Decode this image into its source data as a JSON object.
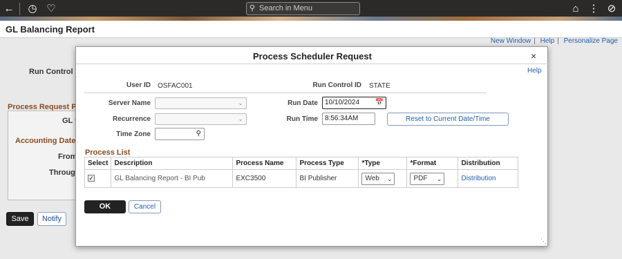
{
  "topbar": {
    "search_placeholder": "Search in Menu",
    "back_icon": "←",
    "history_icon": "◷",
    "favorites_icon": "♡",
    "home_icon": "⌂",
    "more_icon": "⋮",
    "navbar_icon": "⊘"
  },
  "page": {
    "title": "GL Balancing Report",
    "links": [
      "New Window",
      "Help",
      "Personalize Page"
    ],
    "run_control_label": "Run Control ID",
    "section_process_request": "Process Request Param",
    "gl_label": "GL U",
    "accounting_date": "Accounting Date",
    "from_label": "From",
    "through_label": "Through",
    "save_button": "Save",
    "notify_button": "Notify"
  },
  "modal": {
    "title": "Process Scheduler Request",
    "close_icon": "×",
    "help_link": "Help",
    "user_id_label": "User ID",
    "user_id_value": "OSFAC001",
    "run_control_label": "Run Control ID",
    "run_control_value": "STATE",
    "server_name_label": "Server Name",
    "recurrence_label": "Recurrence",
    "time_zone_label": "Time Zone",
    "run_date_label": "Run Date",
    "run_date_value": "10/10/2024",
    "run_time_label": "Run Time",
    "run_time_value": "8:56:34AM",
    "reset_button": "Reset to Current Date/Time",
    "process_list_title": "Process List",
    "columns": [
      "Select",
      "Description",
      "Process Name",
      "Process Type",
      "*Type",
      "*Format",
      "Distribution"
    ],
    "rows": [
      {
        "description": "GL Balancing Report - BI Pub",
        "process_name": "EXC3500",
        "process_type": "BI Publisher",
        "type": "Web",
        "format": "PDF",
        "distribution": "Distribution"
      }
    ],
    "ok_button": "OK",
    "cancel_button": "Cancel"
  }
}
